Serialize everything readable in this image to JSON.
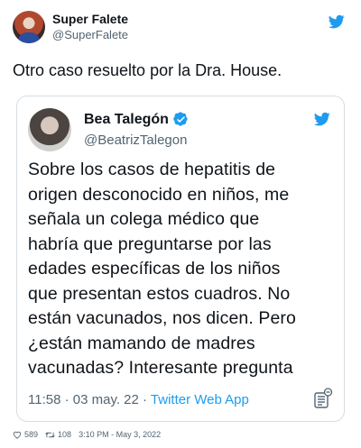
{
  "outer": {
    "name": "Super Falete",
    "handle": "@SuperFalete",
    "text": "Otro caso resuelto por la Dra. House."
  },
  "quoted": {
    "name": "Bea Talegón",
    "handle": "@BeatrizTalegon",
    "lines": [
      "Sobre los casos de hepatitis de",
      "origen desconocido en niños, me",
      "señala un colega médico que",
      "habría que preguntarse por las",
      "edades específicas de los niños",
      "que presentan estos cuadros. No",
      "están vacunados, nos dicen. Pero",
      "¿están mamando de madres",
      "vacunadas? Interesante pregunta"
    ],
    "timestamp": "11:58 · 03 may. 22 · ",
    "app": "Twitter Web App"
  },
  "footer": {
    "likes": "589",
    "retweets": "108",
    "datetime": "3:10 PM - May 3, 2022"
  },
  "colors": {
    "twitter_blue": "#1d9bf0",
    "verified": "#1d9bf0"
  },
  "icons": [
    "twitter-bird-icon",
    "verified-badge-icon",
    "twitter-logo-icon",
    "info-icon",
    "heart-icon",
    "retweet-icon"
  ]
}
